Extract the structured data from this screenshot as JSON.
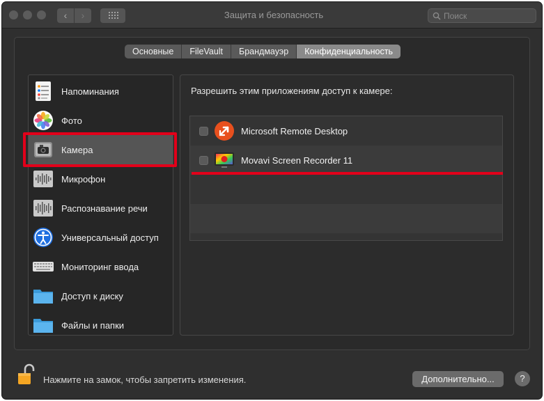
{
  "window": {
    "title": "Защита и безопасность",
    "search_placeholder": "Поиск"
  },
  "tabs": [
    {
      "label": "Основные",
      "active": false
    },
    {
      "label": "FileVault",
      "active": false
    },
    {
      "label": "Брандмауэр",
      "active": false
    },
    {
      "label": "Конфиденциальность",
      "active": true
    }
  ],
  "sidebar": {
    "selected": "Камера",
    "items": [
      {
        "label": "Напоминания",
        "icon": "reminders-icon"
      },
      {
        "label": "Фото",
        "icon": "photos-icon"
      },
      {
        "label": "Камера",
        "icon": "camera-icon"
      },
      {
        "label": "Микрофон",
        "icon": "microphone-icon"
      },
      {
        "label": "Распознавание речи",
        "icon": "speech-recognition-icon"
      },
      {
        "label": "Универсальный доступ",
        "icon": "accessibility-icon"
      },
      {
        "label": "Мониторинг ввода",
        "icon": "keyboard-icon"
      },
      {
        "label": "Доступ к диску",
        "icon": "folder-icon"
      },
      {
        "label": "Файлы и папки",
        "icon": "folder-icon"
      }
    ]
  },
  "panel": {
    "heading": "Разрешить этим приложениям доступ к камере:",
    "apps": [
      {
        "name": "Microsoft Remote Desktop",
        "checked": false,
        "icon": "remote-desktop-icon"
      },
      {
        "name": "Movavi Screen Recorder 11",
        "checked": false,
        "icon": "movavi-icon"
      }
    ]
  },
  "footer": {
    "lock_text": "Нажмите на замок, чтобы запретить изменения.",
    "advanced_label": "Дополнительно...",
    "help_label": "?"
  },
  "colors": {
    "annotation_red": "#e2001a",
    "selected_row": "#555555"
  }
}
